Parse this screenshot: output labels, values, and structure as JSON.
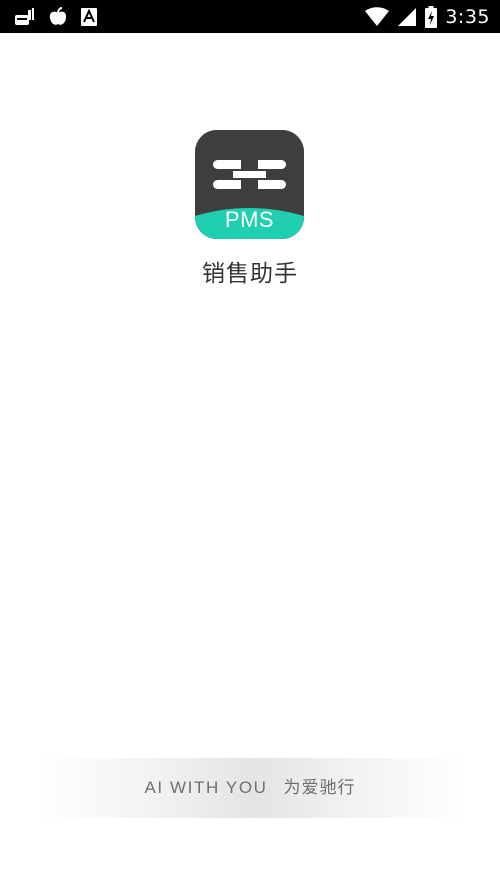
{
  "status_bar": {
    "time": "3:35",
    "icons_left": [
      "gear-notification-icon",
      "apple-notification-icon",
      "text-a-notification-icon"
    ],
    "icons_right": [
      "wifi-icon",
      "cellular-signal-icon",
      "battery-charging-icon"
    ]
  },
  "splash": {
    "icon_text": "PMS",
    "app_name": "销售助手",
    "slogan_en": "AI WITH YOU",
    "slogan_cn": "为爱驰行",
    "colors": {
      "icon_dark": "#3e3e3e",
      "icon_teal": "#1fcfb0",
      "background": "#ffffff",
      "status_bar": "#000000"
    }
  }
}
